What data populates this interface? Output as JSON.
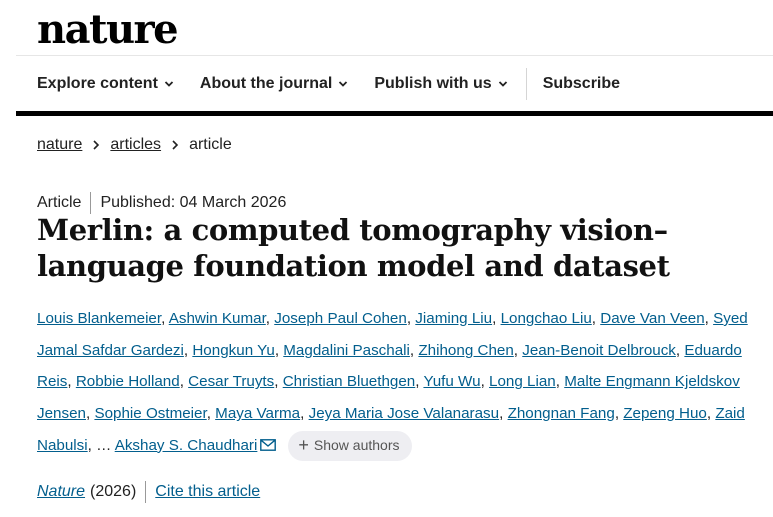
{
  "header": {
    "logo_text": "nature"
  },
  "nav": {
    "items": [
      {
        "label": "Explore content",
        "has_dropdown": true
      },
      {
        "label": "About the journal",
        "has_dropdown": true
      },
      {
        "label": "Publish with us",
        "has_dropdown": true
      },
      {
        "label": "Subscribe",
        "has_dropdown": false
      }
    ]
  },
  "breadcrumb": [
    "nature",
    "articles",
    "article"
  ],
  "article": {
    "type": "Article",
    "published": "Published: 04 March 2026",
    "title": "Merlin: a computed tomography vision–language foundation model and dataset",
    "authors": [
      "Louis Blankemeier",
      "Ashwin Kumar",
      "Joseph Paul Cohen",
      "Jiaming Liu",
      "Longchao Liu",
      "Dave Van Veen",
      "Syed Jamal Safdar Gardezi",
      "Hongkun Yu",
      "Magdalini Paschali",
      "Zhihong Chen",
      "Jean-Benoit Delbrouck",
      "Eduardo Reis",
      "Robbie Holland",
      "Cesar Truyts",
      "Christian Bluethgen",
      "Yufu Wu",
      "Long Lian",
      "Malte Engmann Kjeldskov Jensen",
      "Sophie Ostmeier",
      "Maya Varma",
      "Jeya Maria Jose Valanarasu",
      "Zhongnan Fang",
      "Zepeng Huo",
      "Zaid Nabulsi"
    ],
    "ellipsis": "…",
    "corresponding_author": "Akshay S. Chaudhari",
    "show_authors_label": "Show authors",
    "journal": "Nature",
    "year": "(2026)",
    "cite_label": "Cite this article"
  },
  "icons": {
    "chevron": "chevron-down-icon",
    "crumb": "chevron-right-icon",
    "mail": "mail-icon",
    "plus": "plus-icon"
  },
  "colors": {
    "link": "#025e8d",
    "text": "#222222",
    "rule": "#000000"
  }
}
